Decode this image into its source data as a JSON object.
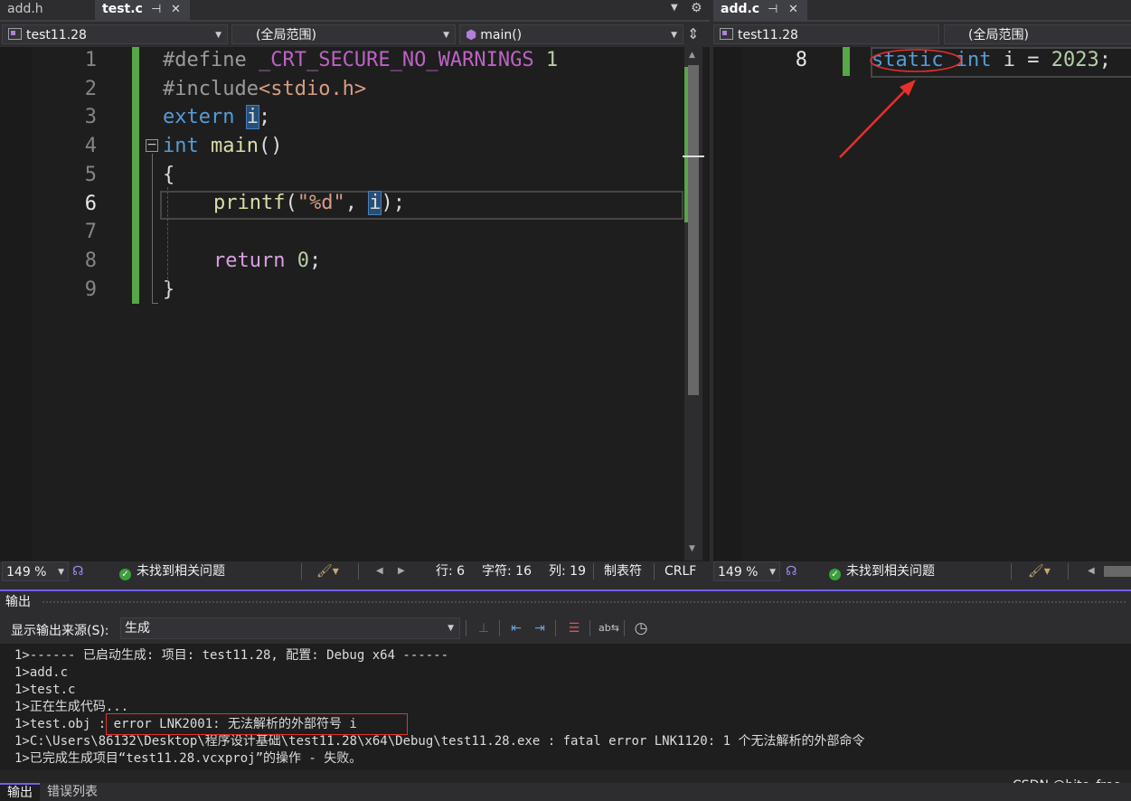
{
  "left_pane": {
    "tabs": [
      {
        "label": "add.h",
        "active": false
      },
      {
        "label": "test.c",
        "active": true
      }
    ],
    "pin_icon": "pin-icon",
    "close_icon": "close-icon",
    "overflow_icon": "chevron-down-icon",
    "settings_icon": "gear-icon",
    "project_dropdown": "test11.28",
    "scope_dropdown": "(全局范围)",
    "member_dropdown": "main()",
    "line_numbers": [
      "1",
      "2",
      "3",
      "4",
      "5",
      "6",
      "7",
      "8",
      "9"
    ],
    "current_line": "6",
    "code": {
      "l1_pp": "#define",
      "l1_macro": "_CRT_SECURE_NO_WARNINGS",
      "l1_num": "1",
      "l2_pp": "#include",
      "l2_hdr": "<stdio.h>",
      "l3_kw": "extern",
      "l3_id": "i",
      "l3_semi": ";",
      "l4_collapse": "−",
      "l4_kw": "int",
      "l4_fn": "main",
      "l4_paren": "()",
      "l5": "{",
      "l6_fn": "printf",
      "l6_open": "(",
      "l6_str": "\"%d\"",
      "l6_comma": ", ",
      "l6_id": "i",
      "l6_close": ");",
      "l8_kw": "return",
      "l8_num": "0",
      "l8_semi": ";",
      "l9": "}"
    },
    "status": {
      "zoom": "149 %",
      "issues": "未找到相关问题",
      "line": "行: 6",
      "char": "字符: 16",
      "col": "列: 19",
      "tabs": "制表符",
      "eol": "CRLF"
    }
  },
  "right_pane": {
    "tab": {
      "label": "add.c",
      "active": true
    },
    "project_dropdown": "test11.28",
    "scope_dropdown": "(全局范围)",
    "line_number": "8",
    "code": {
      "kw1": "static",
      "kw2": "int",
      "rest": " i = ",
      "num": "2023",
      "semi": ";"
    },
    "status": {
      "zoom": "149 %",
      "issues": "未找到相关问题"
    }
  },
  "output": {
    "title": "输出",
    "source_label": "显示输出来源(S):",
    "source_value": "生成",
    "lines": [
      "1>------ 已启动生成: 项目: test11.28, 配置: Debug x64 ------",
      "1>add.c",
      "1>test.c",
      "1>正在生成代码...",
      "1>test.obj : error LNK2001: 无法解析的外部符号 i",
      "1>C:\\Users\\86132\\Desktop\\程序设计基础\\test11.28\\x64\\Debug\\test11.28.exe : fatal error LNK1120: 1 个无法解析的外部命令",
      "1>已完成生成项目“test11.28.vcxproj”的操作 - 失败。"
    ],
    "tabs": [
      "输出",
      "错误列表"
    ]
  },
  "watermark": "CSDN @bite_free",
  "colors": {
    "accent": "#7160e8",
    "annotation_red": "#e8302a",
    "change_bar": "#57a64a"
  }
}
